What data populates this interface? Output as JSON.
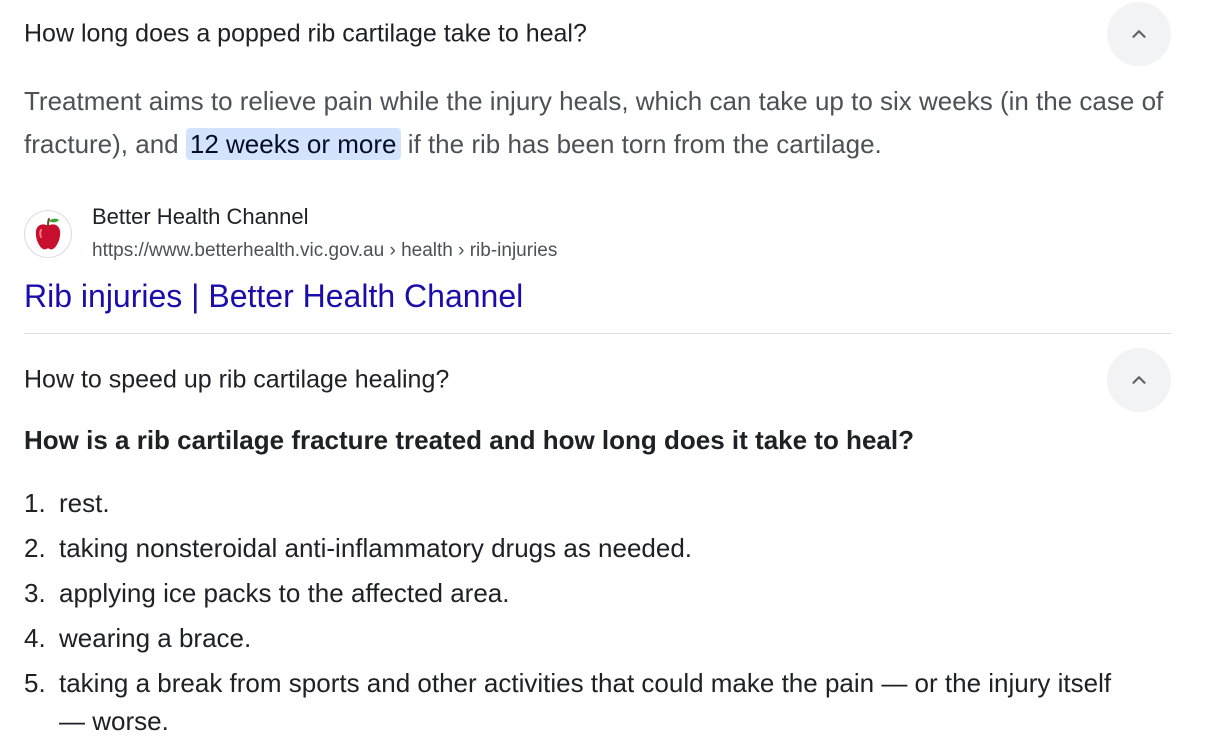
{
  "faq1": {
    "question": "How long does a popped rib cartilage take to heal?",
    "answer_before": "Treatment aims to relieve pain while the injury heals, which can take up to six weeks (in the case of fracture), and ",
    "answer_highlight": "12 weeks or more",
    "answer_after": " if the rib has been torn from the cartilage.",
    "source": {
      "name": "Better Health Channel",
      "url": "https://www.betterhealth.vic.gov.au › health › rib-injuries",
      "favicon_icon": "apple-icon"
    },
    "link_title": "Rib injuries | Better Health Channel",
    "expand_icon": "chevron-up-icon"
  },
  "faq2": {
    "question": "How to speed up rib cartilage healing?",
    "heading": "How is a rib cartilage fracture treated and how long does it take to heal?",
    "expand_icon": "chevron-up-icon",
    "steps": [
      {
        "num": "1.",
        "text": "rest."
      },
      {
        "num": "2.",
        "text": "taking nonsteroidal anti-inflammatory drugs as needed."
      },
      {
        "num": "3.",
        "text": "applying ice packs to the affected area."
      },
      {
        "num": "4.",
        "text": "wearing a brace."
      },
      {
        "num": "5.",
        "text": "taking a break from sports and other activities that could make the pain — or the injury itself — worse."
      }
    ]
  },
  "colors": {
    "link": "#1a0dab",
    "highlight": "#d3e3fd",
    "chevron_bg": "#f1f3f4"
  }
}
